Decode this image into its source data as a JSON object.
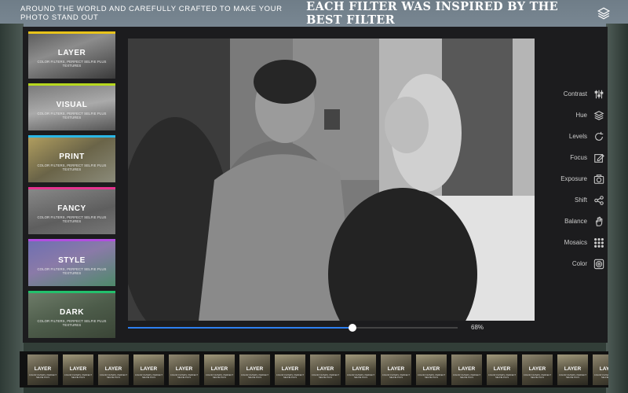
{
  "header": {
    "tagline": "AROUND THE WORLD AND CAREFULLY CRAFTED TO MAKE YOUR PHOTO STAND OUT",
    "headline": "EACH FILTER WAS INSPIRED BY THE BEST FILTER",
    "layers_icon": "stacked-layers-icon"
  },
  "filters": [
    {
      "name": "LAYER",
      "subtitle": "COLOR FILTERS, PERFECT SELFIE PLUS TEXTURES",
      "color": "#e8c31a"
    },
    {
      "name": "VISUAL",
      "subtitle": "COLOR FILTERS, PERFECT SELFIE PLUS TEXTURES",
      "color": "#b7d81e"
    },
    {
      "name": "PRINT",
      "subtitle": "COLOR FILTERS, PERFECT SELFIE PLUS TEXTURES",
      "color": "#2bb7e6"
    },
    {
      "name": "FANCY",
      "subtitle": "COLOR FILTERS, PERFECT SELFIE PLUS TEXTURES",
      "color": "#e6338f"
    },
    {
      "name": "STYLE",
      "subtitle": "COLOR FILTERS, PERFECT SELFIE PLUS TEXTURES",
      "color": "#b24fe0"
    },
    {
      "name": "DARK",
      "subtitle": "COLOR FILTERS, PERFECT SELFIE PLUS TEXTURES",
      "color": "#23c06c"
    }
  ],
  "slider": {
    "value": 0.68,
    "label": "68%",
    "accent": "#2d7ff0"
  },
  "tools": [
    {
      "label": "Contrast",
      "icon": "sliders-icon"
    },
    {
      "label": "Hue",
      "icon": "layers-icon"
    },
    {
      "label": "Levels",
      "icon": "refresh-icon"
    },
    {
      "label": "Focus",
      "icon": "edit-icon"
    },
    {
      "label": "Exposure",
      "icon": "camera-icon"
    },
    {
      "label": "Shift",
      "icon": "share-icon"
    },
    {
      "label": "Balance",
      "icon": "hand-icon"
    },
    {
      "label": "Mosaics",
      "icon": "grid-icon"
    },
    {
      "label": "Color",
      "icon": "color-target-icon"
    }
  ],
  "thumbnails": [
    {
      "name": "LAYER",
      "subtitle": "COLOR FILTERS, PERFECT SELFIE PLUS"
    },
    {
      "name": "LAYER",
      "subtitle": "COLOR FILTERS, PERFECT SELFIE PLUS"
    },
    {
      "name": "LAYER",
      "subtitle": "COLOR FILTERS, PERFECT SELFIE PLUS"
    },
    {
      "name": "LAYER",
      "subtitle": "COLOR FILTERS, PERFECT SELFIE PLUS"
    },
    {
      "name": "LAYER",
      "subtitle": "COLOR FILTERS, PERFECT SELFIE PLUS"
    },
    {
      "name": "LAYER",
      "subtitle": "COLOR FILTERS, PERFECT SELFIE PLUS"
    },
    {
      "name": "LAYER",
      "subtitle": "COLOR FILTERS, PERFECT SELFIE PLUS"
    },
    {
      "name": "LAYER",
      "subtitle": "COLOR FILTERS, PERFECT SELFIE PLUS"
    },
    {
      "name": "LAYER",
      "subtitle": "COLOR FILTERS, PERFECT SELFIE PLUS"
    },
    {
      "name": "LAYER",
      "subtitle": "COLOR FILTERS, PERFECT SELFIE PLUS"
    },
    {
      "name": "LAYER",
      "subtitle": "COLOR FILTERS, PERFECT SELFIE PLUS"
    },
    {
      "name": "LAYER",
      "subtitle": "COLOR FILTERS, PERFECT SELFIE PLUS"
    },
    {
      "name": "LAYER",
      "subtitle": "COLOR FILTERS, PERFECT SELFIE PLUS"
    },
    {
      "name": "LAYER",
      "subtitle": "COLOR FILTERS, PERFECT SELFIE PLUS"
    },
    {
      "name": "LAYER",
      "subtitle": "COLOR FILTERS, PERFECT SELFIE PLUS"
    },
    {
      "name": "LAYER",
      "subtitle": "COLOR FILTERS, PERFECT SELFIE PLUS"
    },
    {
      "name": "LAYER",
      "subtitle": "COLOR FILTERS, PERFECT SELFIE PLUS"
    }
  ]
}
